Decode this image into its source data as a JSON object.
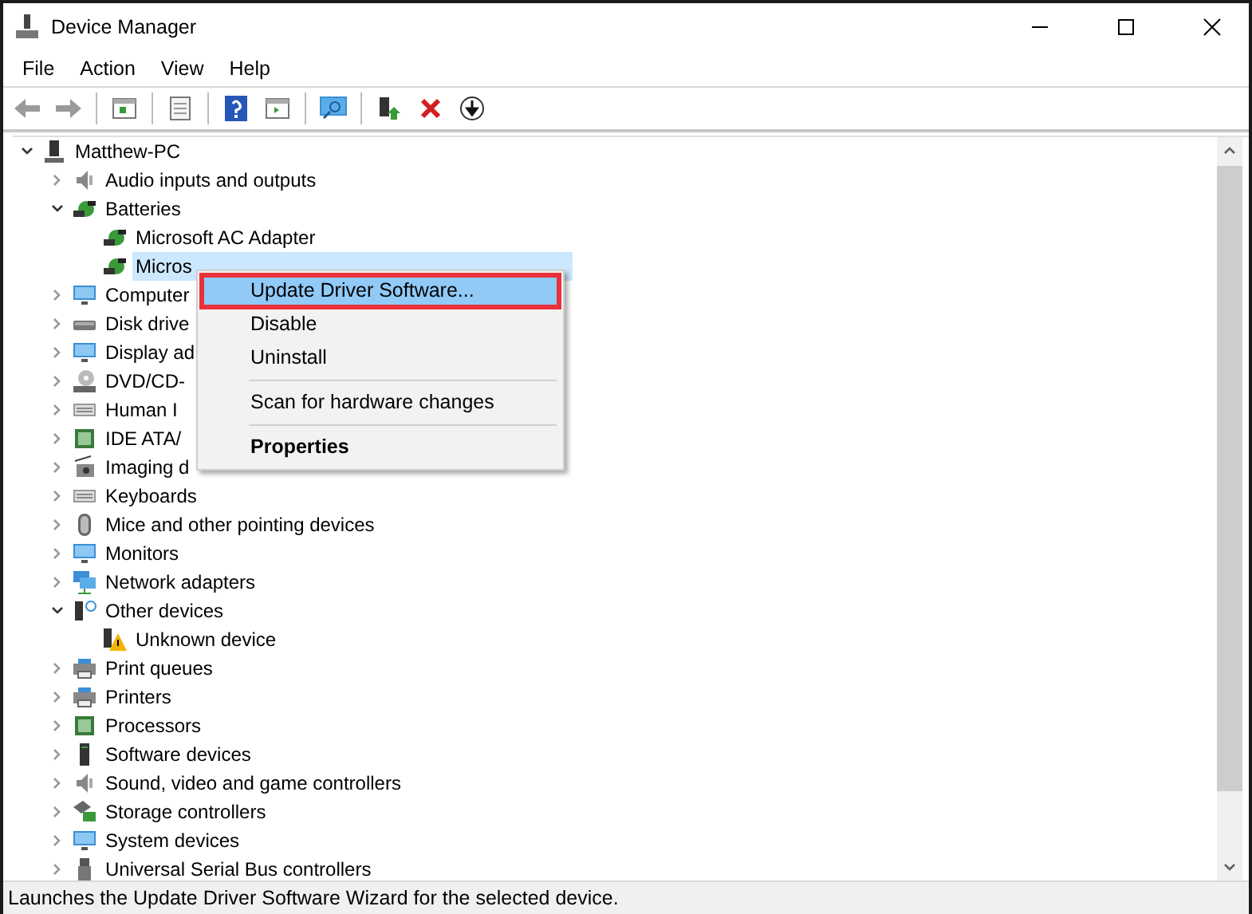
{
  "window": {
    "title": "Device Manager"
  },
  "menu_bar": [
    "File",
    "Action",
    "View",
    "Help"
  ],
  "tree": {
    "label": "Matthew-PC",
    "expanded": true,
    "selected": false,
    "children": [
      {
        "label": "Audio inputs and outputs",
        "expanded": false,
        "selected": false
      },
      {
        "label": "Batteries",
        "expanded": true,
        "selected": false,
        "children": [
          {
            "label": "Microsoft AC Adapter",
            "selected": false
          },
          {
            "label": "Micros",
            "selected": true
          }
        ]
      },
      {
        "label": "Computer",
        "expanded": false,
        "selected": false
      },
      {
        "label": "Disk drive",
        "expanded": false,
        "selected": false
      },
      {
        "label": "Display ad",
        "expanded": false,
        "selected": false
      },
      {
        "label": "DVD/CD-",
        "expanded": false,
        "selected": false
      },
      {
        "label": "Human I",
        "expanded": false,
        "selected": false
      },
      {
        "label": "IDE ATA/",
        "expanded": false,
        "selected": false
      },
      {
        "label": "Imaging d",
        "expanded": false,
        "selected": false
      },
      {
        "label": "Keyboards",
        "expanded": false,
        "selected": false
      },
      {
        "label": "Mice and other pointing devices",
        "expanded": false,
        "selected": false
      },
      {
        "label": "Monitors",
        "expanded": false,
        "selected": false
      },
      {
        "label": "Network adapters",
        "expanded": false,
        "selected": false
      },
      {
        "label": "Other devices",
        "expanded": true,
        "selected": false,
        "children": [
          {
            "label": "Unknown device",
            "selected": false
          }
        ]
      },
      {
        "label": "Print queues",
        "expanded": false,
        "selected": false
      },
      {
        "label": "Printers",
        "expanded": false,
        "selected": false
      },
      {
        "label": "Processors",
        "expanded": false,
        "selected": false
      },
      {
        "label": "Software devices",
        "expanded": false,
        "selected": false
      },
      {
        "label": "Sound, video and game controllers",
        "expanded": false,
        "selected": false
      },
      {
        "label": "Storage controllers",
        "expanded": false,
        "selected": false
      },
      {
        "label": "System devices",
        "expanded": false,
        "selected": false
      },
      {
        "label": "Universal Serial Bus controllers",
        "expanded": false,
        "selected": false
      }
    ]
  },
  "context_menu": {
    "items": [
      {
        "kind": "item",
        "label": "Update Driver Software...",
        "selected": true
      },
      {
        "kind": "item",
        "label": "Disable",
        "selected": false
      },
      {
        "kind": "item",
        "label": "Uninstall",
        "selected": false
      },
      {
        "kind": "separator"
      },
      {
        "kind": "item",
        "label": "Scan for hardware changes",
        "selected": false
      },
      {
        "kind": "separator"
      },
      {
        "kind": "default",
        "label": "Properties",
        "selected": false
      }
    ]
  },
  "status_bar": "Launches the Update Driver Software Wizard for the selected device."
}
